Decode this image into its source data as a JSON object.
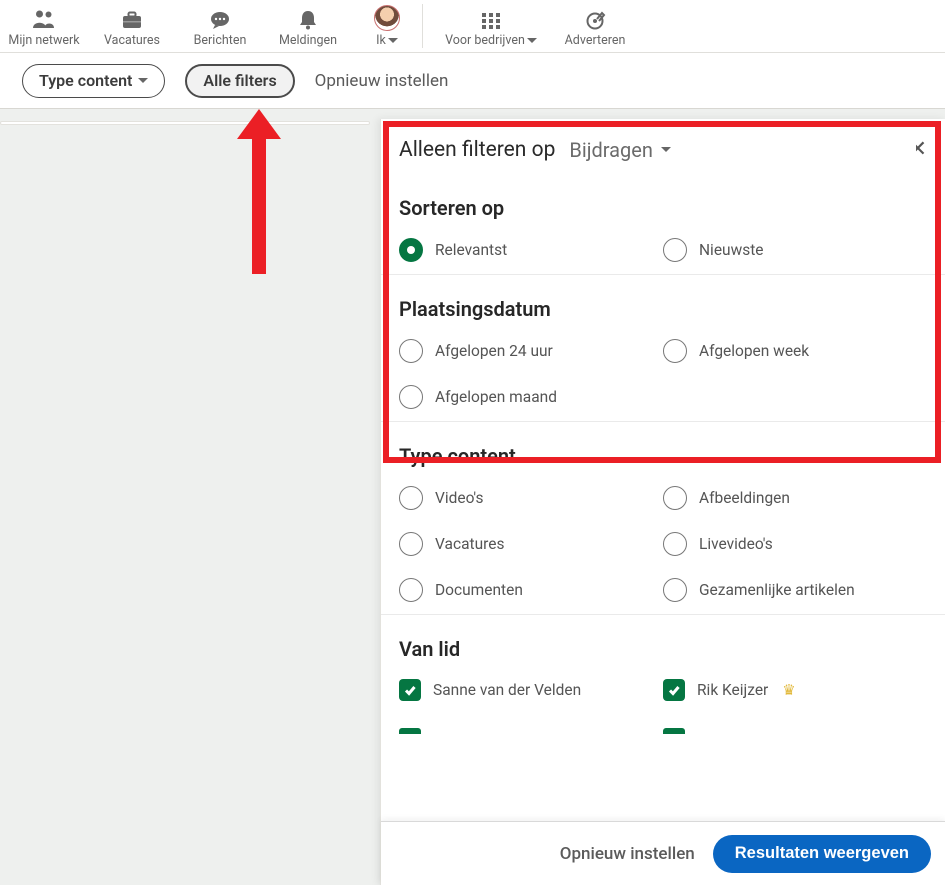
{
  "nav": {
    "left": [
      {
        "label": "Mijn netwerk"
      },
      {
        "label": "Vacatures"
      },
      {
        "label": "Berichten"
      },
      {
        "label": "Meldingen"
      },
      {
        "label": "Ik"
      }
    ],
    "right": [
      {
        "label": "Voor bedrijven"
      },
      {
        "label": "Adverteren"
      }
    ]
  },
  "chips": {
    "type_content": "Type content",
    "all_filters": "Alle filters",
    "reset": "Opnieuw instellen"
  },
  "panel": {
    "header": {
      "label": "Alleen filteren op",
      "value": "Bijdragen"
    },
    "sort": {
      "title": "Sorteren op",
      "options": [
        "Relevantst",
        "Nieuwste"
      ],
      "selected": 0
    },
    "date": {
      "title": "Plaatsingsdatum",
      "options": [
        "Afgelopen 24 uur",
        "Afgelopen week",
        "Afgelopen maand"
      ]
    },
    "ctype": {
      "title": "Type content",
      "options": [
        "Video's",
        "Afbeeldingen",
        "Vacatures",
        "Livevideo's",
        "Documenten",
        "Gezamenlijke artikelen"
      ]
    },
    "from": {
      "title": "Van lid",
      "members": [
        "Sanne van der Velden",
        "Rik Keijzer"
      ]
    },
    "footer": {
      "reset": "Opnieuw instellen",
      "cta": "Resultaten weergeven"
    }
  }
}
